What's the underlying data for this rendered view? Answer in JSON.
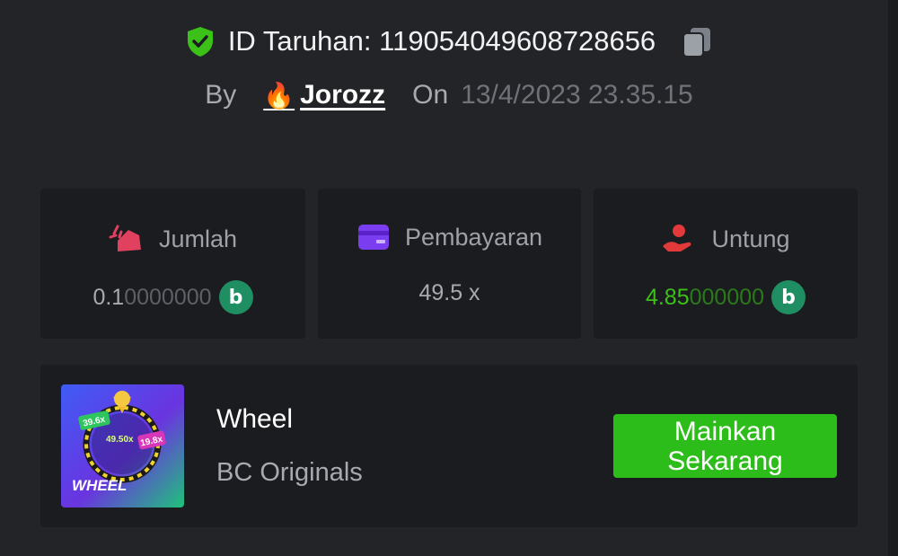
{
  "bet": {
    "id_label": "ID Taruhan:",
    "id_value": "119054049608728656",
    "by_label": "By",
    "user_name": "Jorozz",
    "on_label": "On",
    "datetime": "13/4/2023 23.35.15"
  },
  "stats": [
    {
      "label": "Jumlah",
      "value_main": "0.1",
      "value_rest": "0000000",
      "icon": "bet-amount-icon",
      "value_color": "#a7aab0",
      "coin": "bc-coin-icon"
    },
    {
      "label": "Pembayaran",
      "value_main": "49.5 x",
      "value_rest": "",
      "icon": "payout-card-icon",
      "value_color": "#a7aab0"
    },
    {
      "label": "Untung",
      "value_main": "4.85",
      "value_rest": "000000",
      "icon": "profit-hand-icon",
      "value_color": "#3bc117",
      "coin": "bc-coin-icon"
    }
  ],
  "game": {
    "name": "Wheel",
    "provider": "BC Originals",
    "play_label": "Mainkan Sekarang",
    "thumb_title": "WHEEL",
    "thumb_badges": [
      "39.6x",
      "49.50x",
      "19.8x"
    ]
  },
  "colors": {
    "background": "#232427",
    "card": "#1b1c1f",
    "accent_green": "#2dbd1a",
    "profit_green": "#3bc117",
    "coin_green": "#1f8f63"
  }
}
